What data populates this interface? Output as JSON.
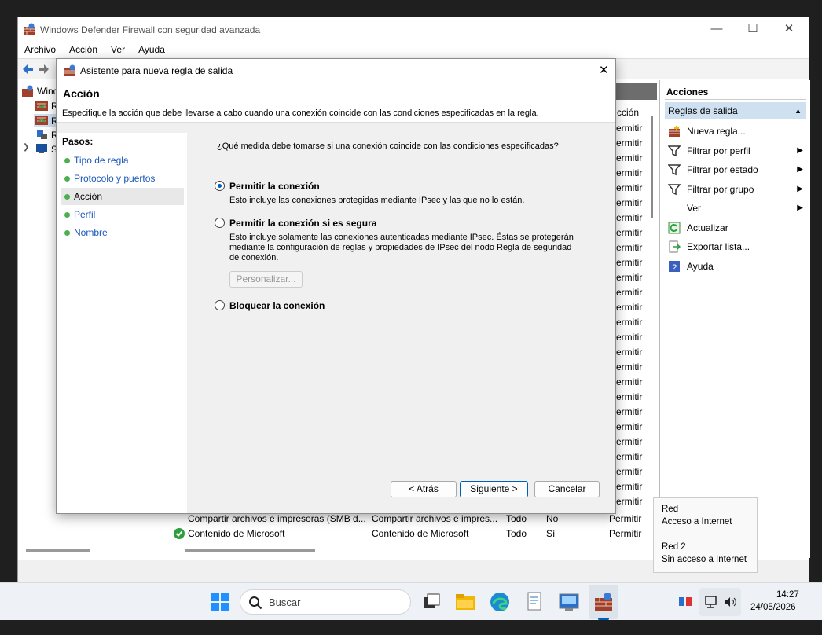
{
  "window": {
    "title": "Windows Defender Firewall con seguridad avanzada",
    "menu": [
      "Archivo",
      "Acción",
      "Ver",
      "Ayuda"
    ]
  },
  "tree": {
    "items": [
      "Windo",
      "R",
      "R",
      "R",
      "S"
    ]
  },
  "center": {
    "column_action": "cción",
    "action_values": [
      "Permitir",
      "Permitir",
      "Permitir",
      "Permitir",
      "Permitir",
      "Permitir",
      "Permitir",
      "Permitir",
      "Permitir",
      "Permitir",
      "Permitir",
      "Permitir",
      "Permitir",
      "Permitir",
      "Permitir",
      "Permitir",
      "Permitir",
      "Permitir",
      "Permitir",
      "Permitir",
      "Permitir",
      "Permitir",
      "Permitir",
      "Permitir",
      "Permitir",
      "Permitir"
    ],
    "rows": [
      {
        "name": "Compartir archivos e impresoras (SMB d...",
        "group": "Compartir archivos e impres...",
        "profile": "Todo",
        "enabled": "No",
        "action": "Permitir"
      },
      {
        "name": "Contenido de Microsoft",
        "group": "Contenido de Microsoft",
        "profile": "Todo",
        "enabled": "Sí",
        "action": "Permitir"
      }
    ]
  },
  "actions": {
    "header": "Acciones",
    "subheader": "Reglas de salida",
    "items": [
      {
        "label": "Nueva regla...",
        "icon": "new-rule-icon",
        "submenu": false
      },
      {
        "label": "Filtrar por perfil",
        "icon": "filter-icon",
        "submenu": true
      },
      {
        "label": "Filtrar por estado",
        "icon": "filter-icon",
        "submenu": true
      },
      {
        "label": "Filtrar por grupo",
        "icon": "filter-icon",
        "submenu": true
      },
      {
        "label": "Ver",
        "icon": "",
        "submenu": true
      },
      {
        "label": "Actualizar",
        "icon": "refresh-icon",
        "submenu": false
      },
      {
        "label": "Exportar lista...",
        "icon": "export-icon",
        "submenu": false
      },
      {
        "label": "Ayuda",
        "icon": "help-icon",
        "submenu": false
      }
    ]
  },
  "dialog": {
    "title": "Asistente para nueva regla de salida",
    "heading": "Acción",
    "description": "Especifique la acción que debe llevarse a cabo cuando una conexión coincide con las condiciones especificadas en la regla.",
    "steps_label": "Pasos:",
    "steps": [
      "Tipo de regla",
      "Protocolo y puertos",
      "Acción",
      "Perfil",
      "Nombre"
    ],
    "active_step": "Acción",
    "question": "¿Qué medida debe tomarse si una conexión coincide con las condiciones especificadas?",
    "options": [
      {
        "label": "Permitir la conexión",
        "desc": "Esto incluye las conexiones protegidas mediante IPsec y las que no lo están.",
        "selected": true
      },
      {
        "label": "Permitir la conexión si es segura",
        "desc": "Esto incluye solamente las conexiones autenticadas mediante IPsec. Éstas se protegerán mediante la configuración de reglas y propiedades de IPsec del nodo Regla de seguridad de conexión.",
        "selected": false
      },
      {
        "label": "Bloquear la conexión",
        "desc": "",
        "selected": false
      }
    ],
    "customize_button": "Personalizar...",
    "back_button": "< Atrás",
    "next_button": "Siguiente >",
    "cancel_button": "Cancelar"
  },
  "network_tooltip": {
    "net1_name": "Red",
    "net1_status": "Acceso a Internet",
    "net2_name": "Red 2",
    "net2_status": "Sin acceso a Internet"
  },
  "taskbar": {
    "search_placeholder": "Buscar",
    "time": "14:27",
    "date": "24/05/2026"
  },
  "colors": {
    "accent": "#005fb8",
    "step_dot": "#4caf50",
    "selection": "#cfe0f1"
  }
}
